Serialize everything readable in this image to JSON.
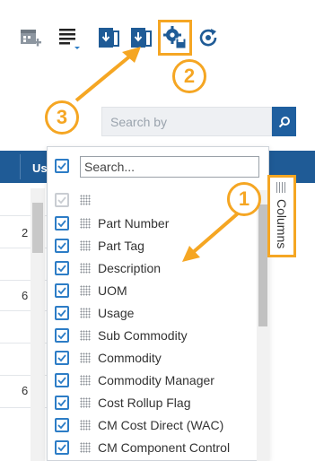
{
  "search": {
    "placeholder": "Search by"
  },
  "grid": {
    "header_label": "Us",
    "cells": [
      "2",
      "6",
      "6"
    ]
  },
  "column_panel": {
    "search_placeholder": "Search...",
    "tab_label": "Columns",
    "items": [
      {
        "label": "",
        "checked": true,
        "disabled": true
      },
      {
        "label": "Part Number",
        "checked": true
      },
      {
        "label": "Part Tag",
        "checked": true
      },
      {
        "label": "Description",
        "checked": true
      },
      {
        "label": "UOM",
        "checked": true
      },
      {
        "label": "Usage",
        "checked": true
      },
      {
        "label": "Sub Commodity",
        "checked": true
      },
      {
        "label": "Commodity",
        "checked": true
      },
      {
        "label": "Commodity Manager",
        "checked": true
      },
      {
        "label": "Cost Rollup Flag",
        "checked": true
      },
      {
        "label": "CM Cost Direct (WAC)",
        "checked": true
      },
      {
        "label": "CM Component Control",
        "checked": true
      }
    ]
  },
  "callouts": [
    "1",
    "2",
    "3"
  ],
  "colors": {
    "accent": "#f5a623",
    "primary": "#1f5b96",
    "checkbox": "#2d7dc6"
  },
  "toolbar_icons": [
    "calendar-add-icon",
    "list-lines-icon",
    "export-icon",
    "import-icon",
    "settings-save-icon",
    "refresh-icon"
  ]
}
